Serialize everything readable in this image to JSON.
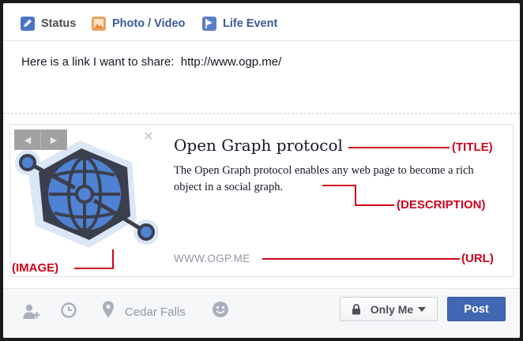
{
  "tabs": {
    "status": "Status",
    "photo_video": "Photo / Video",
    "life_event": "Life Event"
  },
  "composer": {
    "text": "Here is a link I want to share:  http://www.ogp.me/"
  },
  "preview": {
    "title": "Open Graph protocol",
    "description": "The Open Graph protocol enables any web page to become a rich object in a social graph.",
    "url": "WWW.OGP.ME",
    "prev_arrow": "◀",
    "next_arrow": "▶",
    "close_glyph": "✕",
    "image_icon": "open-graph-globe-logo"
  },
  "annotations": {
    "title": "(TITLE)",
    "description": "(DESCRIPTION)",
    "image": "(IMAGE)",
    "url": "(URL)",
    "color": "#d0021b"
  },
  "footer": {
    "location": "Cedar Falls",
    "privacy": "Only Me",
    "post": "Post",
    "icons": [
      "add-friend-icon",
      "clock-icon",
      "location-pin-icon",
      "smiley-icon",
      "lock-icon"
    ]
  },
  "colors": {
    "brand_blue": "#3b5998",
    "post_button": "#4267b2",
    "globe_blue": "#4f82d3",
    "globe_dark": "#3b3f4d"
  }
}
